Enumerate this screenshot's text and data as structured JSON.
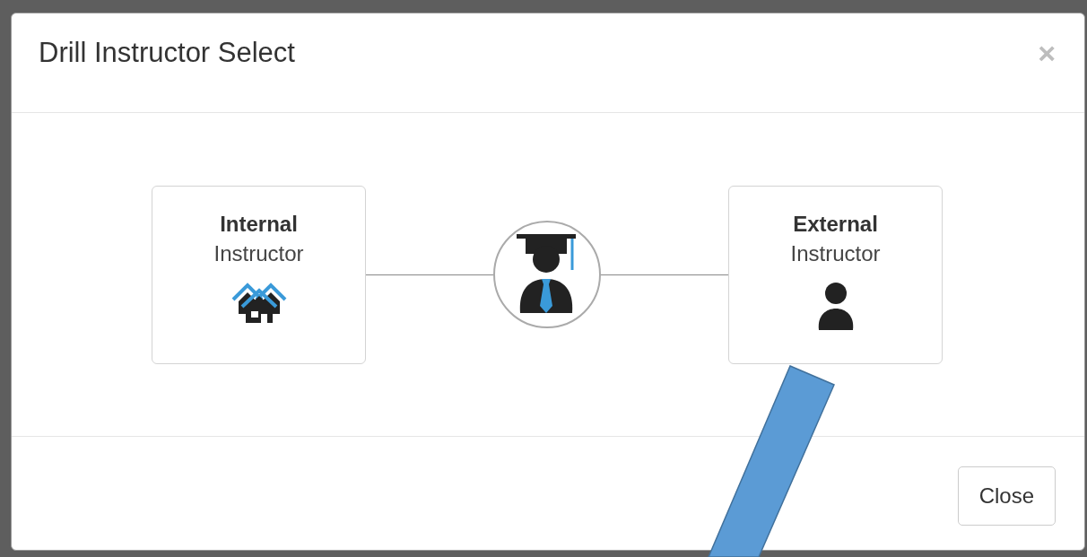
{
  "dialog": {
    "title": "Drill Instructor Select",
    "close_glyph": "×"
  },
  "options": [
    {
      "kind": "internal",
      "title": "Internal",
      "subtitle": "Instructor"
    },
    {
      "kind": "external",
      "title": "External",
      "subtitle": "Instructor"
    }
  ],
  "footer": {
    "buttons": [
      "Close"
    ]
  }
}
